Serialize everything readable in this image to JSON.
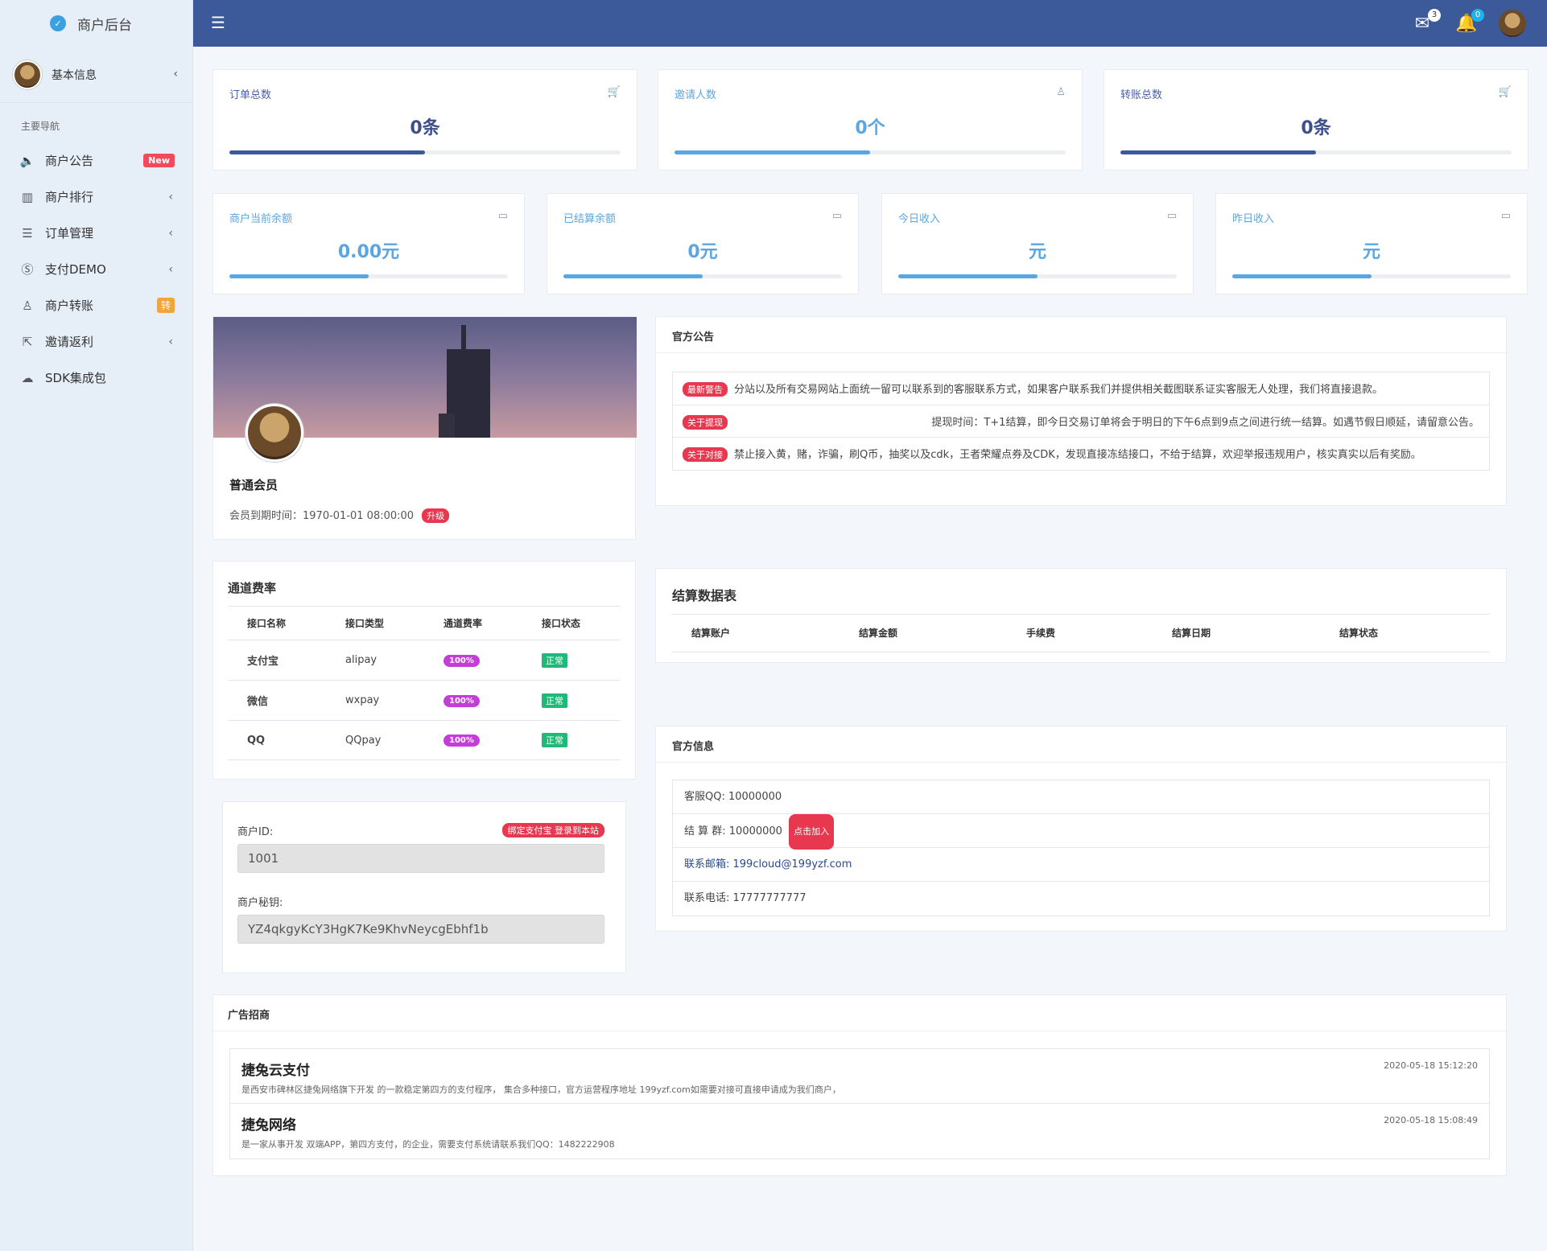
{
  "sidebar": {
    "brand": "商户后台",
    "user_label": "基本信息",
    "nav_header": "主要导航",
    "items": [
      {
        "label": "商户公告",
        "icon": "megaphone-icon",
        "glyph": "🔈",
        "badge": "New"
      },
      {
        "label": "商户排行",
        "icon": "bar-chart-icon",
        "glyph": "▥",
        "chevron": "‹"
      },
      {
        "label": "订单管理",
        "icon": "list-icon",
        "glyph": "☰",
        "chevron": "‹"
      },
      {
        "label": "支付DEMO",
        "icon": "skype-icon",
        "glyph": "Ⓢ",
        "chevron": "‹"
      },
      {
        "label": "商户转账",
        "icon": "user-icon",
        "glyph": "♙",
        "badge": "转"
      },
      {
        "label": "邀请返利",
        "icon": "share-icon",
        "glyph": "⇱",
        "chevron": "‹"
      },
      {
        "label": "SDK集成包",
        "icon": "cloud-icon",
        "glyph": "☁"
      }
    ]
  },
  "topbar": {
    "mail_count": "3",
    "bell_count": "0"
  },
  "stats_row1": [
    {
      "title": "订单总数",
      "value": "0条",
      "progress": 0.5
    },
    {
      "title": "邀请人数",
      "value": "0个",
      "progress": 0.5
    },
    {
      "title": "转账总数",
      "value": "0条",
      "progress": 0.5
    }
  ],
  "stats_row2": [
    {
      "title": "商户当前余额",
      "value": "0.00元",
      "progress": 0.5
    },
    {
      "title": "已结算余额",
      "value": "0元",
      "progress": 0.5
    },
    {
      "title": "今日收入",
      "value": "元",
      "progress": 0.5
    },
    {
      "title": "昨日收入",
      "value": "元",
      "progress": 0.5
    }
  ],
  "profile": {
    "level": "普通会员",
    "expire_label": "会员到期时间：1970-01-01 08:00:00",
    "upgrade": "升级"
  },
  "announcements": {
    "title": "官方公告",
    "items": [
      {
        "tag": "最新警告",
        "text": "分站以及所有交易网站上面统一留可以联系到的客服联系方式，如果客户联系我们并提供相关截图联系证实客服无人处理，我们将直接退款。"
      },
      {
        "tag": "关于提现",
        "text": "提现时间：T+1结算，即今日交易订单将会于明日的下午6点到9点之间进行统一结算。如遇节假日顺延，请留意公告。"
      },
      {
        "tag": "关于对接",
        "text": "禁止接入黄，赌，诈骗，刷Q币，抽奖以及cdk，王者荣耀点券及CDK，发现直接冻结接口，不给于结算，欢迎举报违规用户，核实真实以后有奖励。"
      }
    ]
  },
  "rates": {
    "title": "通道费率",
    "headers": [
      "接口名称",
      "接口类型",
      "通道费率",
      "接口状态"
    ],
    "rows": [
      {
        "name": "支付宝",
        "type": "alipay",
        "rate": "100%",
        "status": "正常"
      },
      {
        "name": "微信",
        "type": "wxpay",
        "rate": "100%",
        "status": "正常"
      },
      {
        "name": "QQ",
        "type": "QQpay",
        "rate": "100%",
        "status": "正常"
      }
    ]
  },
  "settlement": {
    "title": "结算数据表",
    "headers": [
      "结算账户",
      "结算金额",
      "手续费",
      "结算日期",
      "结算状态"
    ]
  },
  "merchant": {
    "id_label": "商户ID:",
    "id_value": "1001",
    "key_label": "商户秘钥:",
    "key_value": "YZ4qkgyKcY3HgK7Ke9KhvNeycgEbhf1b",
    "bind_button": "绑定支付宝 登录到本站"
  },
  "official_info": {
    "title": "官方信息",
    "qq": "客服QQ: 10000000",
    "group": "结 算 群: 10000000",
    "join": "点击加入",
    "email": "联系邮箱: 199cloud@199yzf.com",
    "phone": "联系电话: 17777777777"
  },
  "ads": {
    "title": "广告招商",
    "items": [
      {
        "title": "捷兔云支付",
        "desc": "是西安市碑林区捷兔网络旗下开发 的一款稳定第四方的支付程序， 集合多种接口，官方运营程序地址 199yzf.com如需要对接可直接申请成为我们商户，",
        "time": "2020-05-18 15:12:20"
      },
      {
        "title": "捷兔网络",
        "desc": "是一家从事开发 双端APP，第四方支付，的企业，需要支付系统请联系我们QQ：1482222908",
        "time": "2020-05-18 15:08:49"
      }
    ]
  },
  "colors": {
    "topbar": "#3c5a9a",
    "dark_bar": "#3c5a9a",
    "light_bar": "#5aa6e2",
    "tag_red": "#e8384f"
  }
}
